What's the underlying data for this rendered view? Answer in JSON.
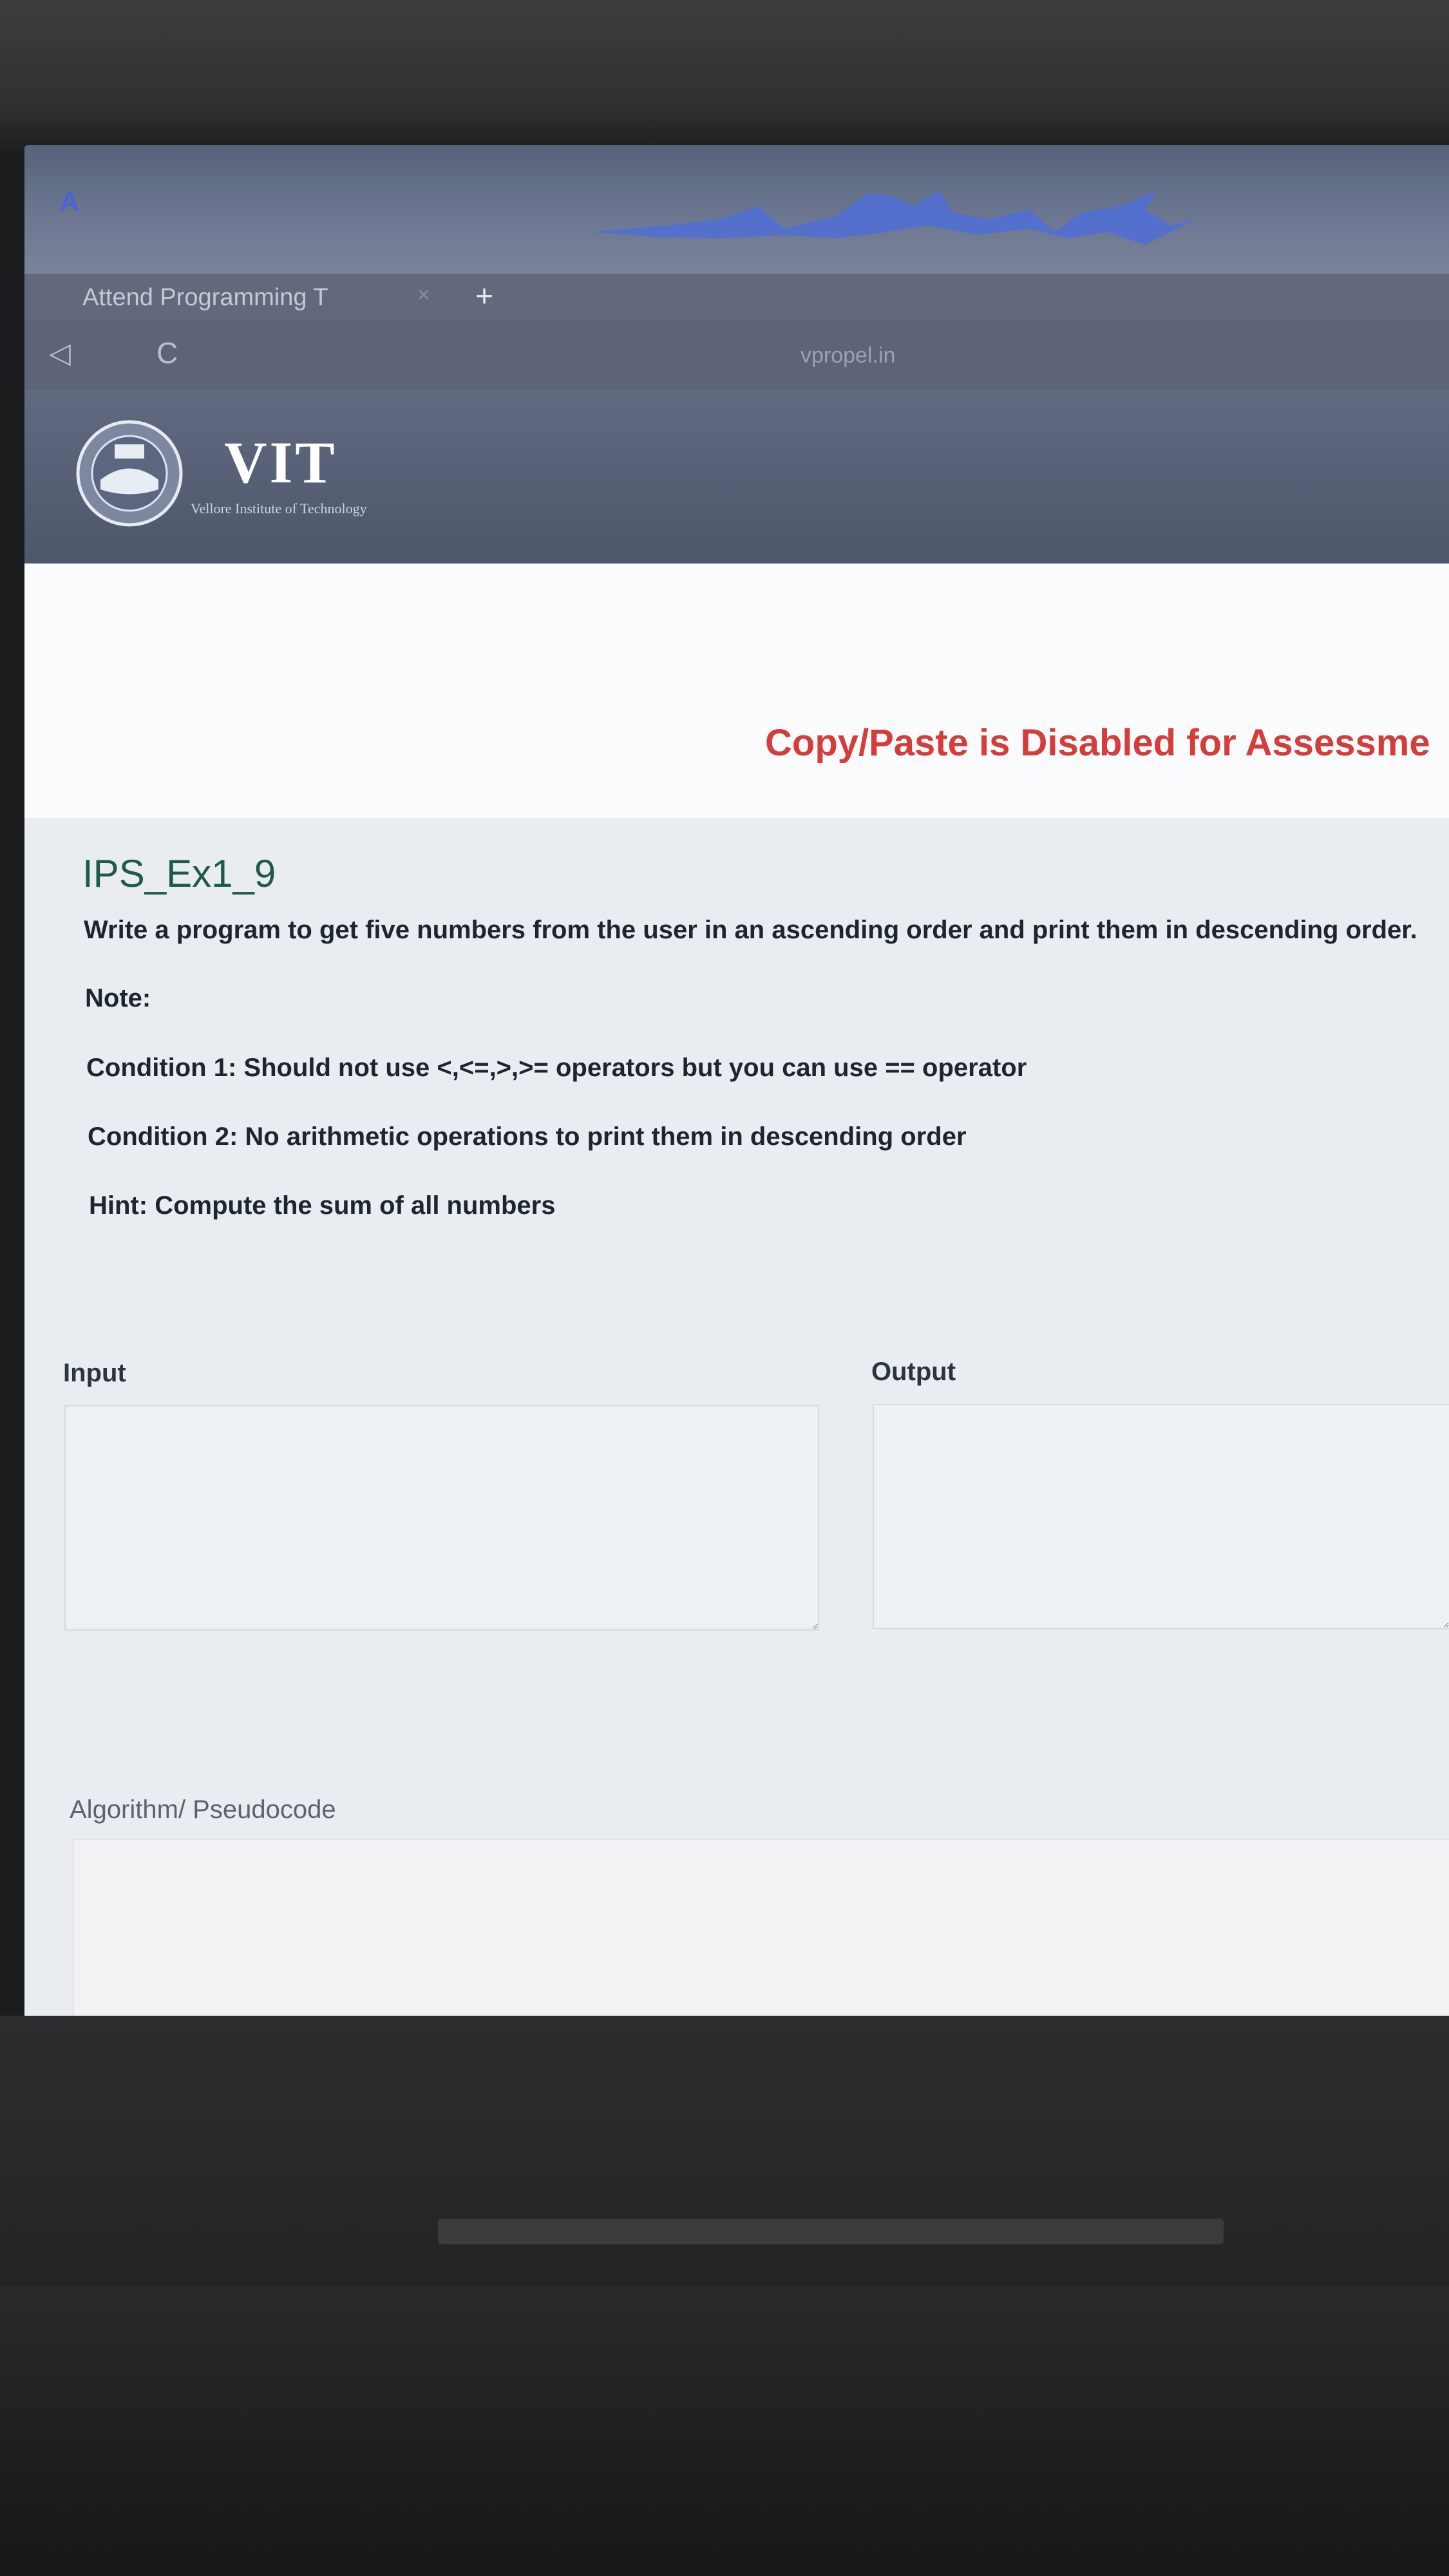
{
  "browser": {
    "tab_title": "Attend Programming T",
    "tab_close": "×",
    "tab_new": "+",
    "back_icon": "◁",
    "reload_icon": "C",
    "url": "vpropel.in"
  },
  "header": {
    "logo_text": "VIT",
    "logo_subtitle": "Vellore Institute of Technology"
  },
  "notice": "Copy/Paste is Disabled for Assessme",
  "question": {
    "title": "IPS_Ex1_9",
    "statement": "Write a program to get five numbers from the user in an ascending order and print them in descending order.",
    "note": "Note:",
    "condition1": "Condition 1: Should not use <,<=,>,>= operators but you can use == operator",
    "condition2": "Condition 2: No arithmetic operations to print them in descending order",
    "hint": "Hint: Compute the sum of all numbers"
  },
  "form": {
    "input_label": "Input",
    "input_value": "",
    "output_label": "Output",
    "output_value": "",
    "algorithm_label": "Algorithm/ Pseudocode",
    "algorithm_value": ""
  },
  "colors": {
    "notice_red": "#d43d3a",
    "title_green": "#1e5a4c",
    "os_logo_blue": "#4a63d8"
  }
}
